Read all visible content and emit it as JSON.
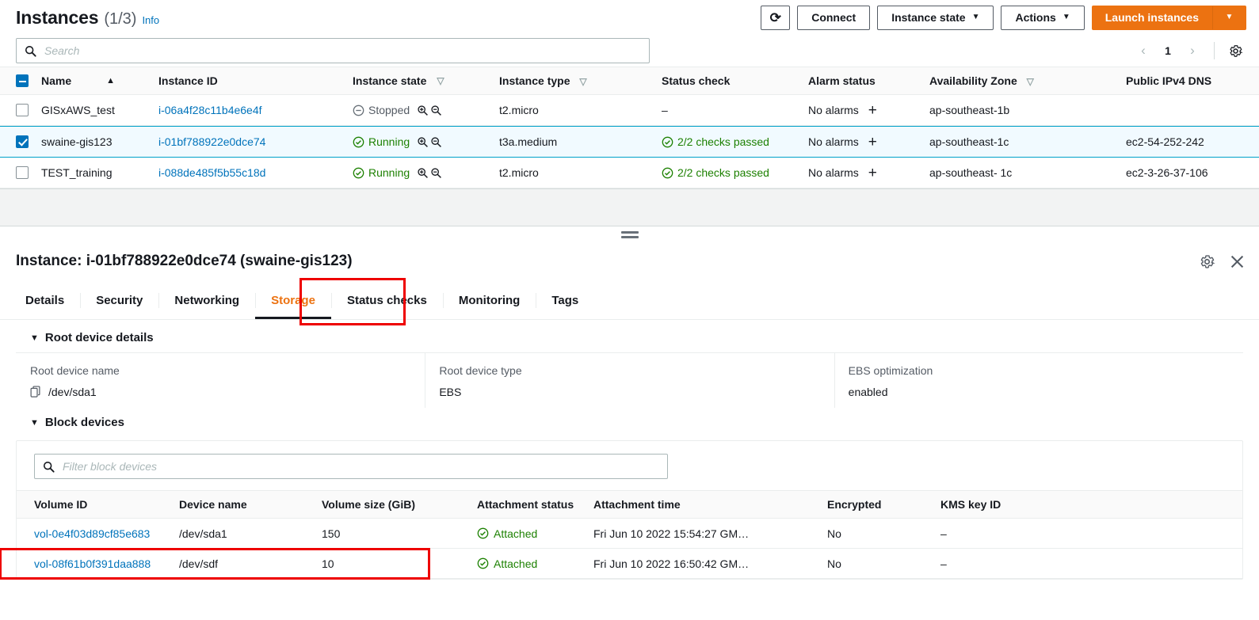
{
  "header": {
    "title": "Instances",
    "count": "(1/3)",
    "info_label": "Info",
    "refresh_icon": "refresh-icon",
    "buttons": {
      "connect": "Connect",
      "instance_state": "Instance state",
      "actions": "Actions",
      "launch": "Launch instances",
      "launch_caret": "▼"
    }
  },
  "search": {
    "placeholder": "Search",
    "value": "",
    "icon": "search-icon"
  },
  "pagination": {
    "prev": "‹",
    "page": "1",
    "next": "›",
    "settings_icon": "gear-icon"
  },
  "instances_table": {
    "columns": [
      {
        "label": "Name",
        "sort": "▲"
      },
      {
        "label": "Instance ID",
        "sort": ""
      },
      {
        "label": "Instance state",
        "sort": "▽"
      },
      {
        "label": "Instance type",
        "sort": "▽"
      },
      {
        "label": "Status check",
        "sort": ""
      },
      {
        "label": "Alarm status",
        "sort": ""
      },
      {
        "label": "Availability Zone",
        "sort": "▽"
      },
      {
        "label": "Public IPv4 DNS",
        "sort": ""
      }
    ],
    "rows": [
      {
        "selected": false,
        "name": "GISxAWS_test",
        "instance_id": "i-06a4f28c11b4e6e4f",
        "state": "Stopped",
        "state_icon": "stopped-icon",
        "type": "t2.micro",
        "status_check": "–",
        "status_ok": false,
        "alarm": "No alarms",
        "alarm_add": "+",
        "az": "ap-southeast-1b",
        "dns": ""
      },
      {
        "selected": true,
        "name": "swaine-gis123",
        "instance_id": "i-01bf788922e0dce74",
        "state": "Running",
        "state_icon": "running-icon",
        "type": "t3a.medium",
        "status_check": "2/2 checks passed",
        "status_ok": true,
        "alarm": "No alarms",
        "alarm_add": "+",
        "az": "ap-southeast-1c",
        "dns": "ec2-54-252-242"
      },
      {
        "selected": false,
        "name": "TEST_training",
        "instance_id": "i-088de485f5b55c18d",
        "state": "Running",
        "state_icon": "running-icon",
        "type": "t2.micro",
        "status_check": "2/2 checks passed",
        "status_ok": true,
        "alarm": "No alarms",
        "alarm_add": "+",
        "az": "ap-southeast- 1c",
        "dns": "ec2-3-26-37-106"
      }
    ]
  },
  "detail": {
    "title": "Instance: i-01bf788922e0dce74 (swaine-gis123)",
    "settings_icon": "gear-icon",
    "close_icon": "close-icon",
    "tabs": [
      {
        "label": "Details",
        "active": false
      },
      {
        "label": "Security",
        "active": false
      },
      {
        "label": "Networking",
        "active": false
      },
      {
        "label": "Storage",
        "active": true
      },
      {
        "label": "Status checks",
        "active": false
      },
      {
        "label": "Monitoring",
        "active": false
      },
      {
        "label": "Tags",
        "active": false
      }
    ]
  },
  "storage": {
    "root_section_title": "Root device details",
    "root_fields": [
      {
        "label": "Root device name",
        "value": "/dev/sda1",
        "copyable": true
      },
      {
        "label": "Root device type",
        "value": "EBS",
        "copyable": false
      },
      {
        "label": "EBS optimization",
        "value": "enabled",
        "copyable": false
      }
    ],
    "block_section_title": "Block devices",
    "filter": {
      "placeholder": "Filter block devices",
      "value": "",
      "icon": "search-icon"
    },
    "block_columns": [
      "Volume ID",
      "Device name",
      "Volume size (GiB)",
      "Attachment status",
      "Attachment time",
      "Encrypted",
      "KMS key ID"
    ],
    "block_rows": [
      {
        "volume_id": "vol-0e4f03d89cf85e683",
        "device_name": "/dev/sda1",
        "volume_size": "150",
        "attachment_status": "Attached",
        "attachment_time": "Fri Jun 10 2022 15:54:27 GM…",
        "encrypted": "No",
        "kms_key_id": "–",
        "highlighted": false
      },
      {
        "volume_id": "vol-08f61b0f391daa888",
        "device_name": "/dev/sdf",
        "volume_size": "10",
        "attachment_status": "Attached",
        "attachment_time": "Fri Jun 10 2022 16:50:42 GM…",
        "encrypted": "No",
        "kms_key_id": "–",
        "highlighted": true
      }
    ]
  },
  "colors": {
    "accent_orange": "#ec7211",
    "link_blue": "#0073bb",
    "success_green": "#1d8102",
    "highlight_red": "#ee0000",
    "selected_row_bg": "#f1faff",
    "selected_row_border": "#00a1c9"
  }
}
